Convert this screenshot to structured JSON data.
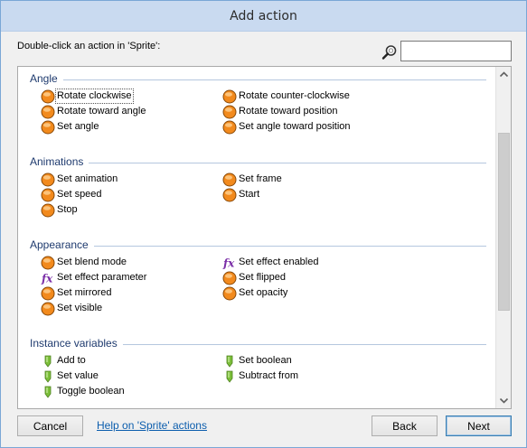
{
  "window": {
    "title": "Add action"
  },
  "prompt": "Double-click an action in 'Sprite':",
  "search": {
    "value": "",
    "placeholder": ""
  },
  "sections": [
    {
      "title": "Angle",
      "actions": [
        {
          "label": "Rotate clockwise",
          "icon": "orange-circle-icon",
          "selected": true
        },
        {
          "label": "Rotate counter-clockwise",
          "icon": "orange-circle-icon"
        },
        {
          "label": "Rotate toward angle",
          "icon": "orange-circle-icon"
        },
        {
          "label": "Rotate toward position",
          "icon": "orange-circle-icon"
        },
        {
          "label": "Set angle",
          "icon": "orange-circle-icon"
        },
        {
          "label": "Set angle toward position",
          "icon": "orange-circle-icon"
        }
      ]
    },
    {
      "title": "Animations",
      "actions": [
        {
          "label": "Set animation",
          "icon": "orange-circle-icon"
        },
        {
          "label": "Set frame",
          "icon": "orange-circle-icon"
        },
        {
          "label": "Set speed",
          "icon": "orange-circle-icon"
        },
        {
          "label": "Start",
          "icon": "orange-circle-icon"
        },
        {
          "label": "Stop",
          "icon": "orange-circle-icon"
        }
      ]
    },
    {
      "title": "Appearance",
      "actions": [
        {
          "label": "Set blend mode",
          "icon": "orange-circle-icon"
        },
        {
          "label": "Set effect enabled",
          "icon": "fx-icon"
        },
        {
          "label": "Set effect parameter",
          "icon": "fx-icon"
        },
        {
          "label": "Set flipped",
          "icon": "orange-circle-icon"
        },
        {
          "label": "Set mirrored",
          "icon": "orange-circle-icon"
        },
        {
          "label": "Set opacity",
          "icon": "orange-circle-icon"
        },
        {
          "label": "Set visible",
          "icon": "orange-circle-icon"
        }
      ]
    },
    {
      "title": "Instance variables",
      "actions": [
        {
          "label": "Add to",
          "icon": "green-marker-icon"
        },
        {
          "label": "Set boolean",
          "icon": "green-marker-icon"
        },
        {
          "label": "Set value",
          "icon": "green-marker-icon"
        },
        {
          "label": "Subtract from",
          "icon": "green-marker-icon"
        },
        {
          "label": "Toggle boolean",
          "icon": "green-marker-icon"
        }
      ]
    }
  ],
  "footer": {
    "cancel_label": "Cancel",
    "help_link": "Help on 'Sprite' actions",
    "back_label": "Back",
    "next_label": "Next"
  },
  "colors": {
    "titlebar": "#c9daf0",
    "section_title": "#1e3a6e",
    "link": "#0b5dad",
    "orange_icon": "#f28a1d",
    "fx_icon": "#7b2fa8",
    "green_icon": "#7cbf3a"
  }
}
